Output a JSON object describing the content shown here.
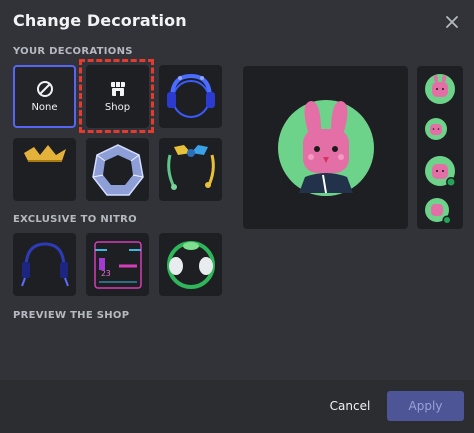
{
  "modal": {
    "title": "Change Decoration",
    "sections": {
      "your_decorations": "YOUR DECORATIONS",
      "exclusive": "EXCLUSIVE TO NITRO",
      "preview_shop": "PREVIEW THE SHOP"
    },
    "tiles": {
      "none_label": "None",
      "shop_label": "Shop"
    },
    "footer": {
      "cancel_label": "Cancel",
      "apply_label": "Apply"
    }
  },
  "colors": {
    "background": "#313338",
    "tile": "#1e1f22",
    "accent": "#5865f2",
    "highlight": "#e33b2f",
    "avatar_pink": "#e46fa6",
    "avatar_green": "#6ed38a"
  },
  "icons": {
    "close": "close-icon",
    "none": "ban-icon",
    "shop": "shop-icon"
  }
}
